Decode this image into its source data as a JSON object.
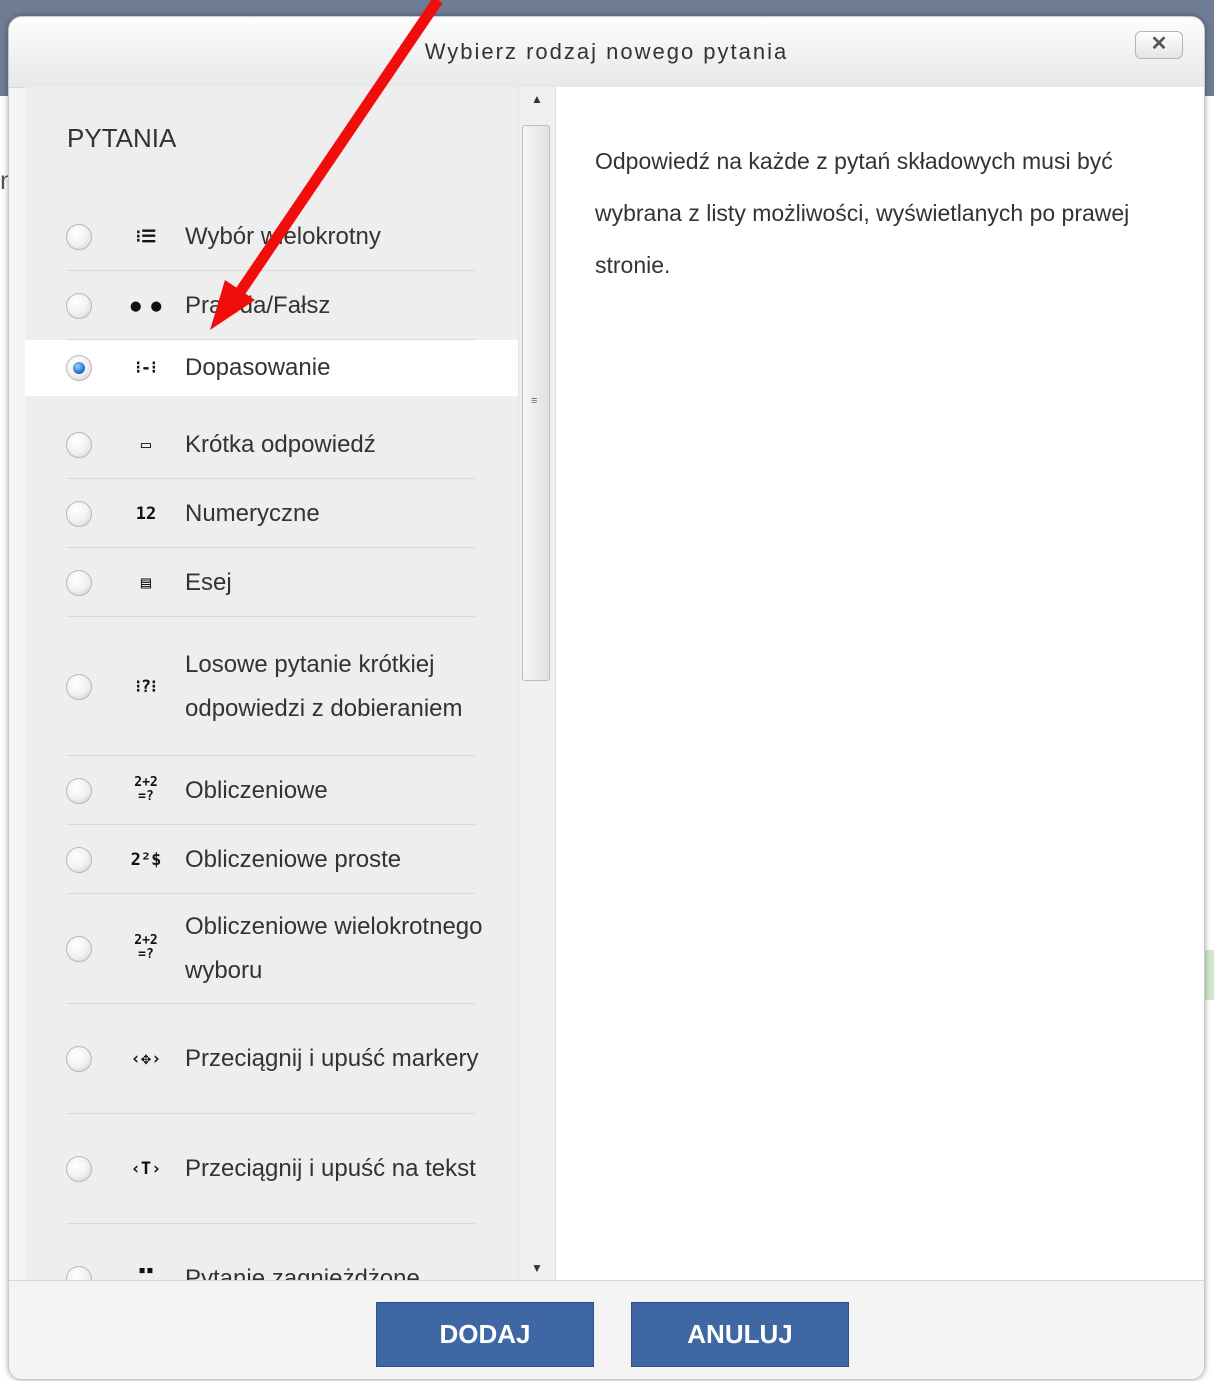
{
  "dialog": {
    "title": "Wybierz rodzaj nowego pytania",
    "close_label": "✕"
  },
  "options": {
    "section_header": "PYTANIA",
    "items": [
      {
        "label": "Wybór wielokrotny",
        "icon": "multichoice-icon",
        "glyph": "⁝☰",
        "selected": false
      },
      {
        "label": "Prawda/Fałsz",
        "icon": "truefalse-icon",
        "glyph": "● ●",
        "selected": false
      },
      {
        "label": "Dopasowanie",
        "icon": "match-icon",
        "glyph": "⁝-⁝",
        "selected": true
      },
      {
        "label": "Krótka odpowiedź",
        "icon": "shortanswer-icon",
        "glyph": "▭",
        "selected": false
      },
      {
        "label": "Numeryczne",
        "icon": "numerical-icon",
        "glyph": "12",
        "selected": false
      },
      {
        "label": "Esej",
        "icon": "essay-icon",
        "glyph": "▤",
        "selected": false
      },
      {
        "label": "Losowe pytanie krótkiej odpowiedzi z dobieraniem",
        "icon": "randomsamatch-icon",
        "glyph": "⁝?⁝",
        "selected": false
      },
      {
        "label": "Obliczeniowe",
        "icon": "calculated-icon",
        "glyph": "2+2\n=?",
        "selected": false
      },
      {
        "label": "Obliczeniowe proste",
        "icon": "calculatedsimple-icon",
        "glyph": "2²$",
        "selected": false
      },
      {
        "label": "Obliczeniowe wielokrotnego wyboru",
        "icon": "calculatedmulti-icon",
        "glyph": "2+2\n=?",
        "selected": false
      },
      {
        "label": "Przeciągnij i upuść markery",
        "icon": "ddmarker-icon",
        "glyph": "‹✥›",
        "selected": false
      },
      {
        "label": "Przeciągnij i upuść na tekst",
        "icon": "ddwtos-icon",
        "glyph": "‹T›",
        "selected": false
      },
      {
        "label": "Pytanie zagnieżdżone",
        "icon": "multianswer-icon",
        "glyph": "▪▪\n▬▬",
        "selected": false
      }
    ]
  },
  "description": "Odpowiedź na każde z pytań składowych musi być wybrana z listy możliwości, wyświetlanych po prawej stronie.",
  "buttons": {
    "add": "DODAJ",
    "cancel": "ANULUJ"
  },
  "scrollbar": {
    "up_arrow": "▲",
    "down_arrow": "▼",
    "grip": "≡"
  },
  "colors": {
    "button_bg": "#3e67a3",
    "annotation_arrow": "#f20d0d",
    "selected_row": "#ffffff"
  },
  "backdrop": {
    "partial_text": "ni"
  }
}
